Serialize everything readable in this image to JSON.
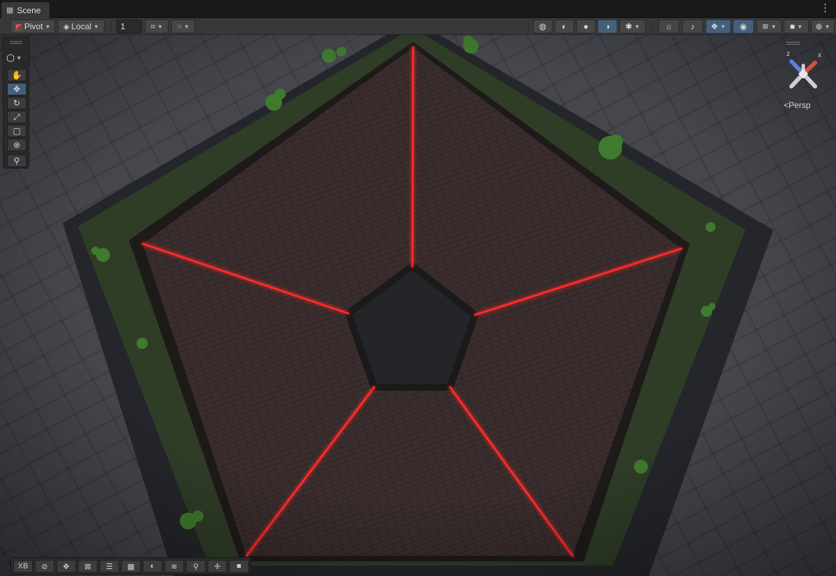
{
  "window": {
    "tab_label": "Scene",
    "tab_icon": "scene-grid-icon",
    "menu_icon": "kebab-menu-icon"
  },
  "toolbar": {
    "pivot_label": "Pivot",
    "local_label": "Local",
    "snap_increment": "1"
  },
  "overlays": {
    "toolbar_right_icons": [
      "wireframe-globe-icon",
      "shaded-wireframe-icon",
      "shaded-icon",
      "lit-shaded-icon",
      "debug-bug-icon",
      "lighting-toggle-icon",
      "audio-toggle-icon",
      "effects-icon",
      "visibility-eye-icon",
      "layers-icon",
      "camera-icon",
      "gizmos-icon"
    ],
    "tools": [
      "hand-tool-icon",
      "move-tool-icon",
      "rotate-tool-icon",
      "scale-tool-icon",
      "rect-tool-icon",
      "transform-tool-icon",
      "custom-tool-icon"
    ],
    "bottom_buttons": [
      "XB",
      "compass-icon",
      "move-icon",
      "xform-icon",
      "align-icon",
      "grid-icon",
      "moon-icon",
      "layers-icon",
      "search-icon",
      "pivot-move-icon",
      "camera-record-icon"
    ]
  },
  "gizmo": {
    "projection_label": "Persp",
    "axis_z": "z",
    "axis_x": "x"
  },
  "colors": {
    "accent": "#46607c",
    "laser": "#ff2a2a",
    "roof": "#3a2b2b",
    "grass": "#2f3d27"
  }
}
